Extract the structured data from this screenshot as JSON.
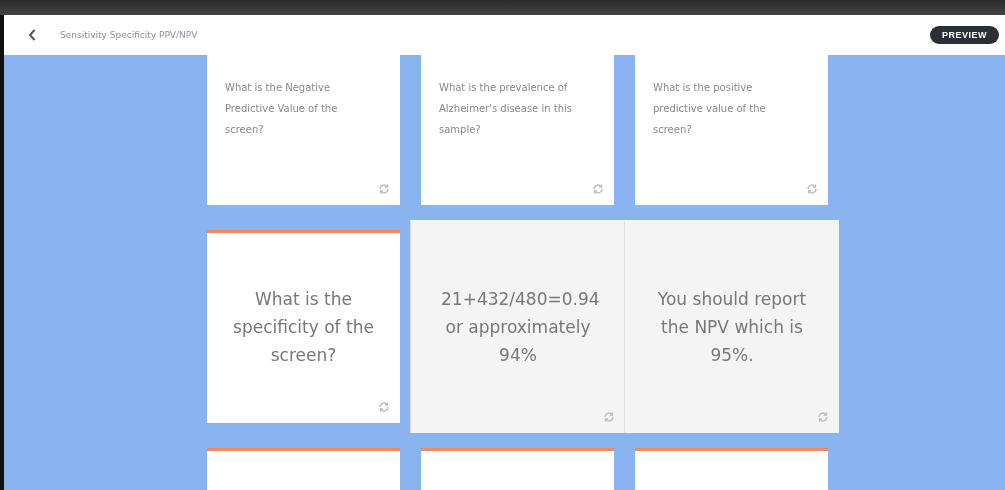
{
  "header": {
    "title": "Sensitivity Specificity PPV/NPV",
    "preview_button": "PREVIEW"
  },
  "rows": [
    {
      "kind": "small",
      "cards": [
        {
          "text": "What is the Negative Predictive Value of the screen?",
          "flipped": false
        },
        {
          "text": "What is the prevalence of Alzheimer's disease in this sample?",
          "flipped": false
        },
        {
          "text": "What is the positive predictive value of the screen?",
          "flipped": false
        }
      ]
    },
    {
      "kind": "large",
      "cards": [
        {
          "text": "What is the specificity of the screen?",
          "flipped": false
        },
        {
          "text": "21+432/480=0.94 or approximately 94%",
          "flipped": true
        },
        {
          "text": "You should report the NPV which is 95%.",
          "flipped": true
        }
      ]
    },
    {
      "kind": "stub",
      "cards": [
        {
          "flipped": false
        },
        {
          "flipped": false
        },
        {
          "flipped": false
        }
      ]
    }
  ]
}
